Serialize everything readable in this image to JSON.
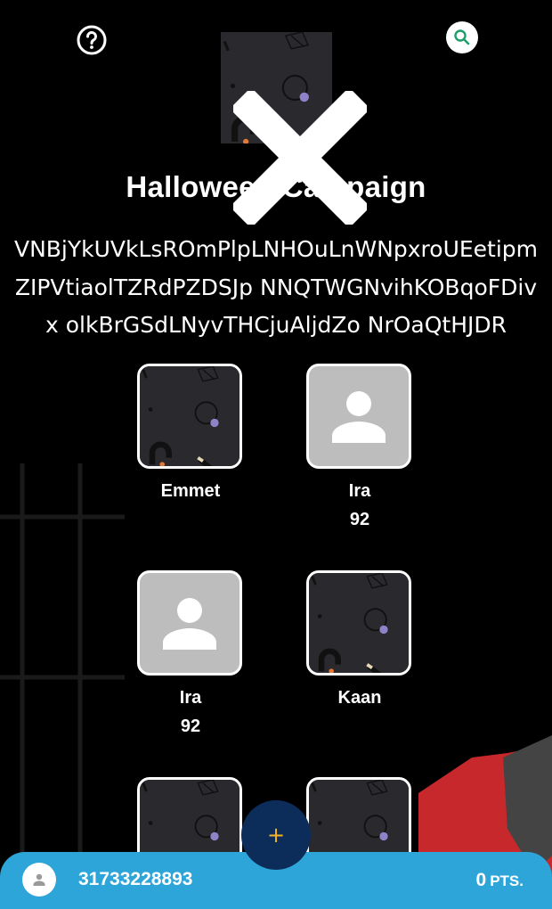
{
  "header": {
    "help_icon": "question-circle-icon",
    "search_icon": "magnifier-icon"
  },
  "campaign": {
    "title": "Halloween Campaign",
    "description_lines": [
      "VNBjYkUVkLsROmPlpLNHOuLnWNpxroUEetipm",
      "ZIPVtiaolTZRdPZDSJp NNQTWGNvihKOBqoFDiv",
      "x olkBrGSdLNyvTHCjuAljdZo NrOaQtHJDR"
    ]
  },
  "participants": [
    {
      "name": "Emmet",
      "score": "",
      "image": "pattern"
    },
    {
      "name": "Ira",
      "score": "92",
      "image": "placeholder"
    },
    {
      "name": "Ira",
      "score": "92",
      "image": "placeholder"
    },
    {
      "name": "Kaan",
      "score": "",
      "image": "pattern"
    },
    {
      "name": "",
      "score": "",
      "image": "pattern"
    },
    {
      "name": "",
      "score": "",
      "image": "pattern"
    }
  ],
  "fab": {
    "label": "+"
  },
  "bottom_bar": {
    "phone": "31733228893",
    "points_value": "0",
    "points_unit": "PTS."
  },
  "colors": {
    "background": "#000000",
    "accent_blue": "#2ea5d8",
    "fab_navy": "#0c2d5a",
    "fab_plus": "#f5b427",
    "search_green": "#1e9e6a",
    "tile_dark": "#2a292d",
    "placeholder_gray": "#bdbdbd"
  }
}
